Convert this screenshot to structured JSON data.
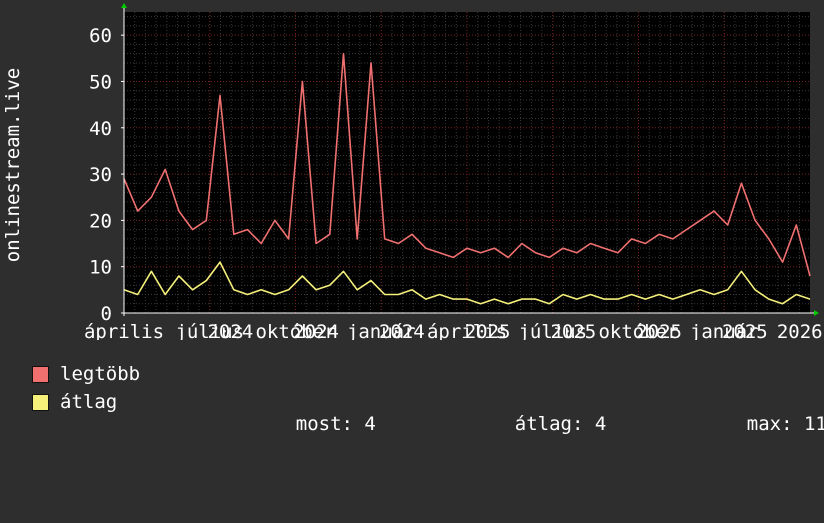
{
  "chart_data": {
    "type": "line",
    "ylabel": "onlinestream.live",
    "ylim": [
      0,
      65
    ],
    "yticks": [
      0,
      10,
      20,
      30,
      40,
      50,
      60
    ],
    "xticks": [
      {
        "label": "április",
        "x": 0.0
      },
      {
        "label": "július",
        "x": 0.125
      },
      {
        "label": "2024",
        "x": 0.155
      },
      {
        "label": "október",
        "x": 0.25
      },
      {
        "label": "2024",
        "x": 0.28
      },
      {
        "label": "január",
        "x": 0.375
      },
      {
        "label": "2024",
        "x": 0.405
      },
      {
        "label": "április",
        "x": 0.5
      },
      {
        "label": "2025",
        "x": 0.53
      },
      {
        "label": "július",
        "x": 0.625
      },
      {
        "label": "2025",
        "x": 0.655
      },
      {
        "label": "október",
        "x": 0.75
      },
      {
        "label": "2025",
        "x": 0.78
      },
      {
        "label": "január",
        "x": 0.875
      },
      {
        "label": "2025",
        "x": 0.905
      },
      {
        "label": "2026",
        "x": 0.985
      }
    ],
    "grid": true,
    "colors": {
      "background": "#000000",
      "grid_minor": "#3a3a3a",
      "grid_major": "#7a2020",
      "axis": "#ffffff",
      "max_series": "#f07070",
      "avg_series": "#f5f07a"
    },
    "series": [
      {
        "name": "legtöbb",
        "color": "#f07070",
        "x": [
          0,
          0.02,
          0.04,
          0.06,
          0.08,
          0.1,
          0.12,
          0.14,
          0.16,
          0.18,
          0.2,
          0.22,
          0.24,
          0.26,
          0.28,
          0.3,
          0.32,
          0.34,
          0.36,
          0.38,
          0.4,
          0.42,
          0.44,
          0.46,
          0.48,
          0.5,
          0.52,
          0.54,
          0.56,
          0.58,
          0.6,
          0.62,
          0.64,
          0.66,
          0.68,
          0.7,
          0.72,
          0.74,
          0.76,
          0.78,
          0.8,
          0.82,
          0.84,
          0.86,
          0.88,
          0.9,
          0.92,
          0.94,
          0.96,
          0.98,
          1.0
        ],
        "values": [
          29,
          22,
          25,
          31,
          22,
          18,
          20,
          47,
          17,
          18,
          15,
          20,
          16,
          50,
          15,
          17,
          56,
          16,
          54,
          16,
          15,
          17,
          14,
          13,
          12,
          14,
          13,
          14,
          12,
          15,
          13,
          12,
          14,
          13,
          15,
          14,
          13,
          16,
          15,
          17,
          16,
          18,
          20,
          22,
          19,
          28,
          20,
          16,
          11,
          19,
          8
        ]
      },
      {
        "name": "átlag",
        "color": "#f5f07a",
        "x": [
          0,
          0.02,
          0.04,
          0.06,
          0.08,
          0.1,
          0.12,
          0.14,
          0.16,
          0.18,
          0.2,
          0.22,
          0.24,
          0.26,
          0.28,
          0.3,
          0.32,
          0.34,
          0.36,
          0.38,
          0.4,
          0.42,
          0.44,
          0.46,
          0.48,
          0.5,
          0.52,
          0.54,
          0.56,
          0.58,
          0.6,
          0.62,
          0.64,
          0.66,
          0.68,
          0.7,
          0.72,
          0.74,
          0.76,
          0.78,
          0.8,
          0.82,
          0.84,
          0.86,
          0.88,
          0.9,
          0.92,
          0.94,
          0.96,
          0.98,
          1.0
        ],
        "values": [
          5,
          4,
          9,
          4,
          8,
          5,
          7,
          11,
          5,
          4,
          5,
          4,
          5,
          8,
          5,
          6,
          9,
          5,
          7,
          4,
          4,
          5,
          3,
          4,
          3,
          3,
          2,
          3,
          2,
          3,
          3,
          2,
          4,
          3,
          4,
          3,
          3,
          4,
          3,
          4,
          3,
          4,
          5,
          4,
          5,
          9,
          5,
          3,
          2,
          4,
          3
        ]
      }
    ],
    "legend": {
      "items": [
        {
          "name": "legtöbb",
          "color": "#f07070"
        },
        {
          "name": "átlag",
          "color": "#f5f07a"
        }
      ],
      "stats": [
        {
          "label": "most:",
          "value": "4"
        },
        {
          "label": "átlag:",
          "value": "4"
        },
        {
          "label": "max:",
          "value": "11"
        }
      ]
    }
  }
}
